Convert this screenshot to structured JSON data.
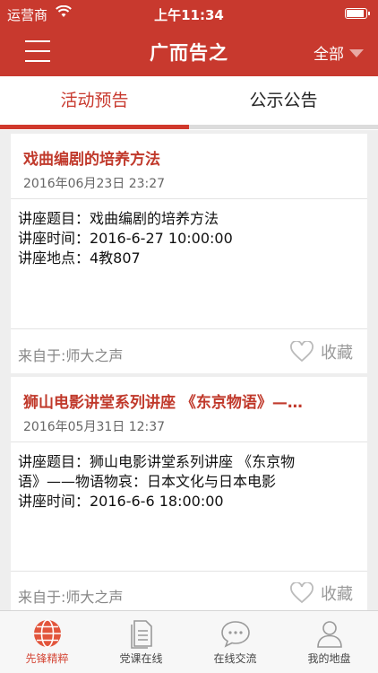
{
  "status_bar": {
    "carrier": "运营商",
    "time": "上午11:34"
  },
  "nav": {
    "title": "广而告之",
    "filter_label": "全部"
  },
  "tabs": [
    {
      "label": "活动预告",
      "active": true
    },
    {
      "label": "公示公告",
      "active": false
    }
  ],
  "cards": [
    {
      "title": "戏曲编剧的培养方法",
      "date": "2016年06月23日 23:27",
      "body_lines": [
        "讲座题目：戏曲编剧的培养方法",
        "讲座时间：2016-6-27 10:00:00",
        "讲座地点：4教807"
      ],
      "source": "来自于:师大之声",
      "fav_label": "收藏"
    },
    {
      "title": "狮山电影讲堂系列讲座 《东京物语》—…",
      "date": "2016年05月31日 12:37",
      "body_lines": [
        "讲座题目：狮山电影讲堂系列讲座 《东京物",
        "语》——物语物哀：日本文化与日本电影",
        "讲座时间：2016-6-6 18:00:00"
      ],
      "source": "来自于:师大之声",
      "fav_label": "收藏"
    }
  ],
  "tabbar": [
    {
      "label": "先锋精粹",
      "icon": "globe-icon",
      "active": true
    },
    {
      "label": "党课在线",
      "icon": "document-icon",
      "active": false
    },
    {
      "label": "在线交流",
      "icon": "chat-bubble-icon",
      "active": false
    },
    {
      "label": "我的地盘",
      "icon": "user-icon",
      "active": false
    }
  ],
  "colors": {
    "brand_red": "#c8392e",
    "card_title_red": "#c0392b",
    "active_tab_orange": "#d54a3a"
  }
}
